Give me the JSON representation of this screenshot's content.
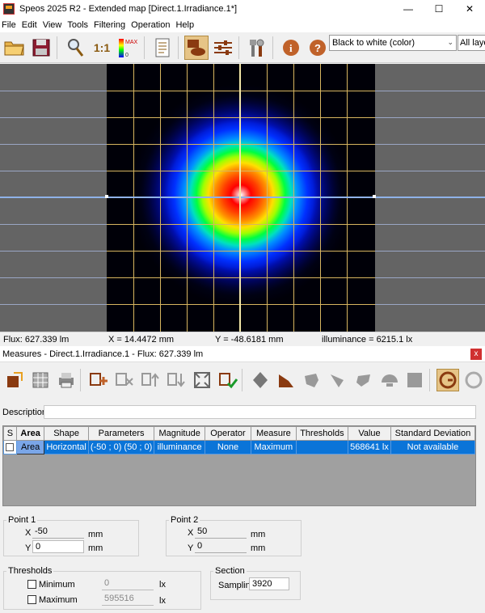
{
  "window": {
    "title": "Speos 2025 R2 - Extended map [Direct.1.Irradiance.1*]",
    "minimize": "—",
    "maximize": "☐",
    "close": "✕"
  },
  "menu": [
    "File",
    "Edit",
    "View",
    "Tools",
    "Filtering",
    "Operation",
    "Help"
  ],
  "toolbar": {
    "one_to_one": "1:1",
    "palette_max": "MAX",
    "palette_zero": "0",
    "color_scale": "Black to white (color)",
    "layers": "All layers"
  },
  "status": {
    "flux": "Flux: 627.339 lm",
    "x": "X = 14.4472 mm",
    "y": "Y = -48.6181 mm",
    "value": "illuminance = 6215.1 lx"
  },
  "measures": {
    "title": "Measures - Direct.1.Irradiance.1 - Flux: 627.339 lm",
    "close": "x",
    "description_label": "Description",
    "description_value": "",
    "columns": [
      "S",
      "Area",
      "Shape",
      "Parameters",
      "Magnitude",
      "Operator",
      "Measure",
      "Thresholds",
      "Value",
      "Standard Deviation"
    ],
    "rows": [
      {
        "area": "Area",
        "shape": "Horizontal",
        "parameters": "(-50 ; 0) (50 ; 0)",
        "magnitude": "illuminance",
        "operator": "None",
        "measure": "Maximum",
        "thresholds": "",
        "value": "568641 lx",
        "std": "Not available"
      }
    ]
  },
  "point1": {
    "label": "Point 1",
    "x_label": "X",
    "x": "-50",
    "y_label": "Y",
    "y": "0",
    "unit": "mm"
  },
  "point2": {
    "label": "Point 2",
    "x_label": "X",
    "x": "50",
    "y_label": "Y",
    "y": "0",
    "unit": "mm"
  },
  "thresholds": {
    "label": "Thresholds",
    "min_label": "Minimum",
    "min_value": "0",
    "max_label": "Maximum",
    "max_value": "595516",
    "unit": "lx"
  },
  "section": {
    "label": "Section",
    "sampling_label": "Sampling",
    "sampling": "3920"
  }
}
